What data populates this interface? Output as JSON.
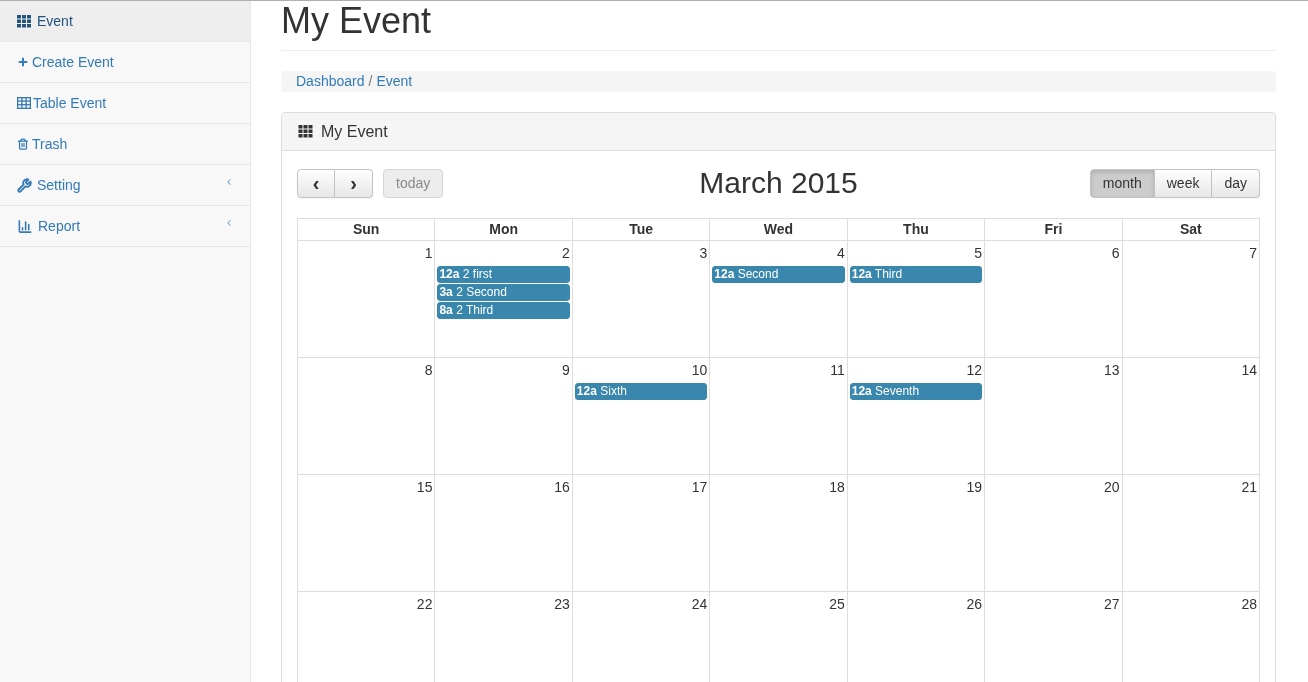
{
  "sidebar": {
    "items": [
      {
        "label": "Event",
        "selected": true,
        "collapsible": false
      },
      {
        "label": "Create Event",
        "selected": false,
        "collapsible": false
      },
      {
        "label": "Table Event",
        "selected": false,
        "collapsible": false
      },
      {
        "label": "Trash",
        "selected": false,
        "collapsible": false
      },
      {
        "label": "Setting",
        "selected": false,
        "collapsible": true
      },
      {
        "label": "Report",
        "selected": false,
        "collapsible": true
      }
    ]
  },
  "page": {
    "title": "My Event"
  },
  "breadcrumb": {
    "items": [
      "Dashboard",
      "Event"
    ],
    "separator": "/"
  },
  "panel": {
    "title": "My Event"
  },
  "calendar": {
    "prev": "‹",
    "next": "›",
    "today": {
      "label": "today",
      "disabled": true
    },
    "title": "March 2015",
    "views": [
      {
        "label": "month",
        "selected": true
      },
      {
        "label": "week",
        "selected": false
      },
      {
        "label": "day",
        "selected": false
      }
    ],
    "weekdays": [
      "Sun",
      "Mon",
      "Tue",
      "Wed",
      "Thu",
      "Fri",
      "Sat"
    ],
    "weeks": [
      [
        {
          "day": "1"
        },
        {
          "day": "2",
          "events": [
            {
              "time": "12a",
              "title": "2 first"
            },
            {
              "time": "3a",
              "title": "2 Second"
            },
            {
              "time": "8a",
              "title": "2 Third"
            }
          ]
        },
        {
          "day": "3"
        },
        {
          "day": "4",
          "events": [
            {
              "time": "12a",
              "title": "Second"
            }
          ]
        },
        {
          "day": "5",
          "events": [
            {
              "time": "12a",
              "title": "Third"
            }
          ]
        },
        {
          "day": "6"
        },
        {
          "day": "7"
        }
      ],
      [
        {
          "day": "8"
        },
        {
          "day": "9"
        },
        {
          "day": "10",
          "events": [
            {
              "time": "12a",
              "title": "Sixth"
            }
          ]
        },
        {
          "day": "11"
        },
        {
          "day": "12",
          "events": [
            {
              "time": "12a",
              "title": "Seventh"
            }
          ]
        },
        {
          "day": "13"
        },
        {
          "day": "14"
        }
      ],
      [
        {
          "day": "15"
        },
        {
          "day": "16"
        },
        {
          "day": "17"
        },
        {
          "day": "18"
        },
        {
          "day": "19"
        },
        {
          "day": "20"
        },
        {
          "day": "21"
        }
      ],
      [
        {
          "day": "22"
        },
        {
          "day": "23"
        },
        {
          "day": "24"
        },
        {
          "day": "25"
        },
        {
          "day": "26"
        },
        {
          "day": "27"
        },
        {
          "day": "28"
        }
      ]
    ]
  }
}
